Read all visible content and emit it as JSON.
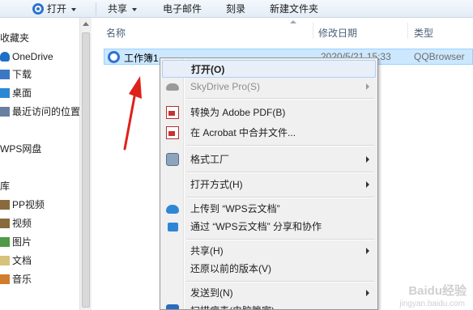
{
  "toolbar": {
    "open_label": "打开",
    "share_label": "共享",
    "email_label": "电子邮件",
    "burn_label": "刻录",
    "new_folder_label": "新建文件夹"
  },
  "nav": {
    "favorites": "收藏夹",
    "items": [
      {
        "label": "OneDrive",
        "icon": "cloud-icon"
      },
      {
        "label": "下载",
        "icon": "download-folder-icon"
      },
      {
        "label": "桌面",
        "icon": "desktop-icon"
      },
      {
        "label": "最近访问的位置",
        "icon": "recent-places-icon"
      }
    ],
    "wps": "WPS网盘",
    "library": "库",
    "library_items": [
      {
        "label": "PP视频",
        "icon": "video-icon"
      },
      {
        "label": "视频",
        "icon": "video-icon"
      },
      {
        "label": "图片",
        "icon": "pictures-icon"
      },
      {
        "label": "文档",
        "icon": "documents-icon"
      },
      {
        "label": "音乐",
        "icon": "music-icon"
      }
    ]
  },
  "list": {
    "columns": {
      "name": "名称",
      "date": "修改日期",
      "type": "类型"
    },
    "file": {
      "name": "工作簿1",
      "date": "2020/5/21 15:33",
      "type": "QQBrowser"
    }
  },
  "menu": {
    "items": [
      {
        "label": "打开(O)",
        "bold": true
      },
      {
        "label": "SkyDrive Pro(S)",
        "icon": "skydrive-icon",
        "disabled": true,
        "submenu": true
      },
      {
        "label": "转换为 Adobe PDF(B)",
        "icon": "adobe-pdf-icon"
      },
      {
        "label": "在 Acrobat 中合并文件...",
        "icon": "acrobat-combine-icon"
      },
      {
        "label": "格式工厂",
        "icon": "format-factory-icon",
        "submenu": true
      },
      {
        "label": "打开方式(H)",
        "submenu": true
      },
      {
        "label": "上传到 “WPS云文档”",
        "icon": "upload-cloud-icon"
      },
      {
        "label": "通过 “WPS云文档” 分享和协作",
        "icon": "share-icon"
      },
      {
        "label": "共享(H)",
        "submenu": true
      },
      {
        "label": "还原以前的版本(V)"
      },
      {
        "label": "发送到(N)",
        "submenu": true
      },
      {
        "label": "扫描病毒(电脑管家)",
        "icon": "qq-pc-manager-icon"
      }
    ]
  },
  "watermark": {
    "text": "Baidu经验",
    "url": "jingyan.baidu.com"
  },
  "colors": {
    "selection": "#cce8ff",
    "arrow": "#e0201a",
    "menu_bg": "#f0f0f0"
  }
}
